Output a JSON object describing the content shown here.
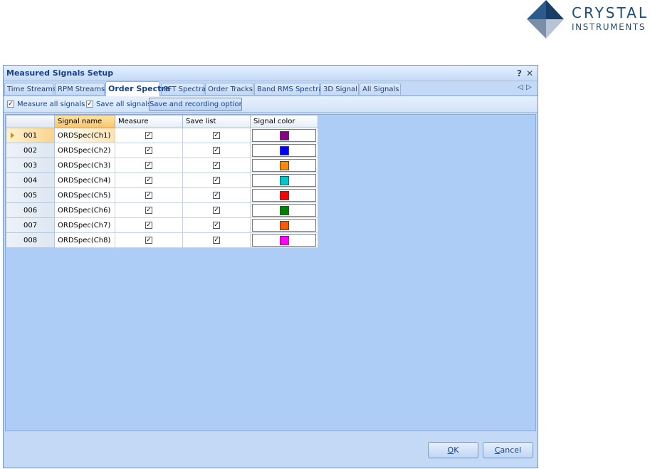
{
  "logo": {
    "line1": "CRYSTAL",
    "line2": "INSTRUMENTS",
    "colors": [
      "#2c5a8a",
      "#1a3d66",
      "#7a8ea6",
      "#b7c4d4"
    ]
  },
  "window": {
    "title": "Measured Signals Setup",
    "help_glyph": "?",
    "close_glyph": "✕"
  },
  "tabs": [
    {
      "label": "Time Streams",
      "active": false
    },
    {
      "label": "RPM Streams",
      "active": false
    },
    {
      "label": "Order Spectra",
      "active": true
    },
    {
      "label": "FFT Spectra",
      "active": false
    },
    {
      "label": "Order Tracks",
      "active": false
    },
    {
      "label": "Band RMS Spectra",
      "active": false
    },
    {
      "label": "3D Signal",
      "active": false
    },
    {
      "label": "All Signals",
      "active": false
    }
  ],
  "tab_nav": {
    "prev": "◁",
    "next": "▷"
  },
  "toolbar": {
    "measure_all": {
      "label": "Measure all signals",
      "checked": true
    },
    "save_all": {
      "label": "Save all signals",
      "checked": true
    },
    "options_button": "Save and recording options"
  },
  "grid": {
    "columns": [
      "Signal name",
      "Measure",
      "Save list",
      "Signal color"
    ],
    "rows": [
      {
        "id": "001",
        "name": "ORDSpec(Ch1)",
        "measure": true,
        "save": true,
        "color": "#8b008b",
        "current": true
      },
      {
        "id": "002",
        "name": "ORDSpec(Ch2)",
        "measure": true,
        "save": true,
        "color": "#0000ff",
        "current": false
      },
      {
        "id": "003",
        "name": "ORDSpec(Ch3)",
        "measure": true,
        "save": true,
        "color": "#ff8c00",
        "current": false
      },
      {
        "id": "004",
        "name": "ORDSpec(Ch4)",
        "measure": true,
        "save": true,
        "color": "#00c8c8",
        "current": false
      },
      {
        "id": "005",
        "name": "ORDSpec(Ch5)",
        "measure": true,
        "save": true,
        "color": "#ff0000",
        "current": false
      },
      {
        "id": "006",
        "name": "ORDSpec(Ch6)",
        "measure": true,
        "save": true,
        "color": "#008000",
        "current": false
      },
      {
        "id": "007",
        "name": "ORDSpec(Ch7)",
        "measure": true,
        "save": true,
        "color": "#ff5a00",
        "current": false
      },
      {
        "id": "008",
        "name": "ORDSpec(Ch8)",
        "measure": true,
        "save": true,
        "color": "#ff00ff",
        "current": false
      }
    ]
  },
  "buttons": {
    "ok_prefix": "O",
    "ok_rest": "K",
    "cancel_prefix": "C",
    "cancel_rest": "ancel"
  }
}
